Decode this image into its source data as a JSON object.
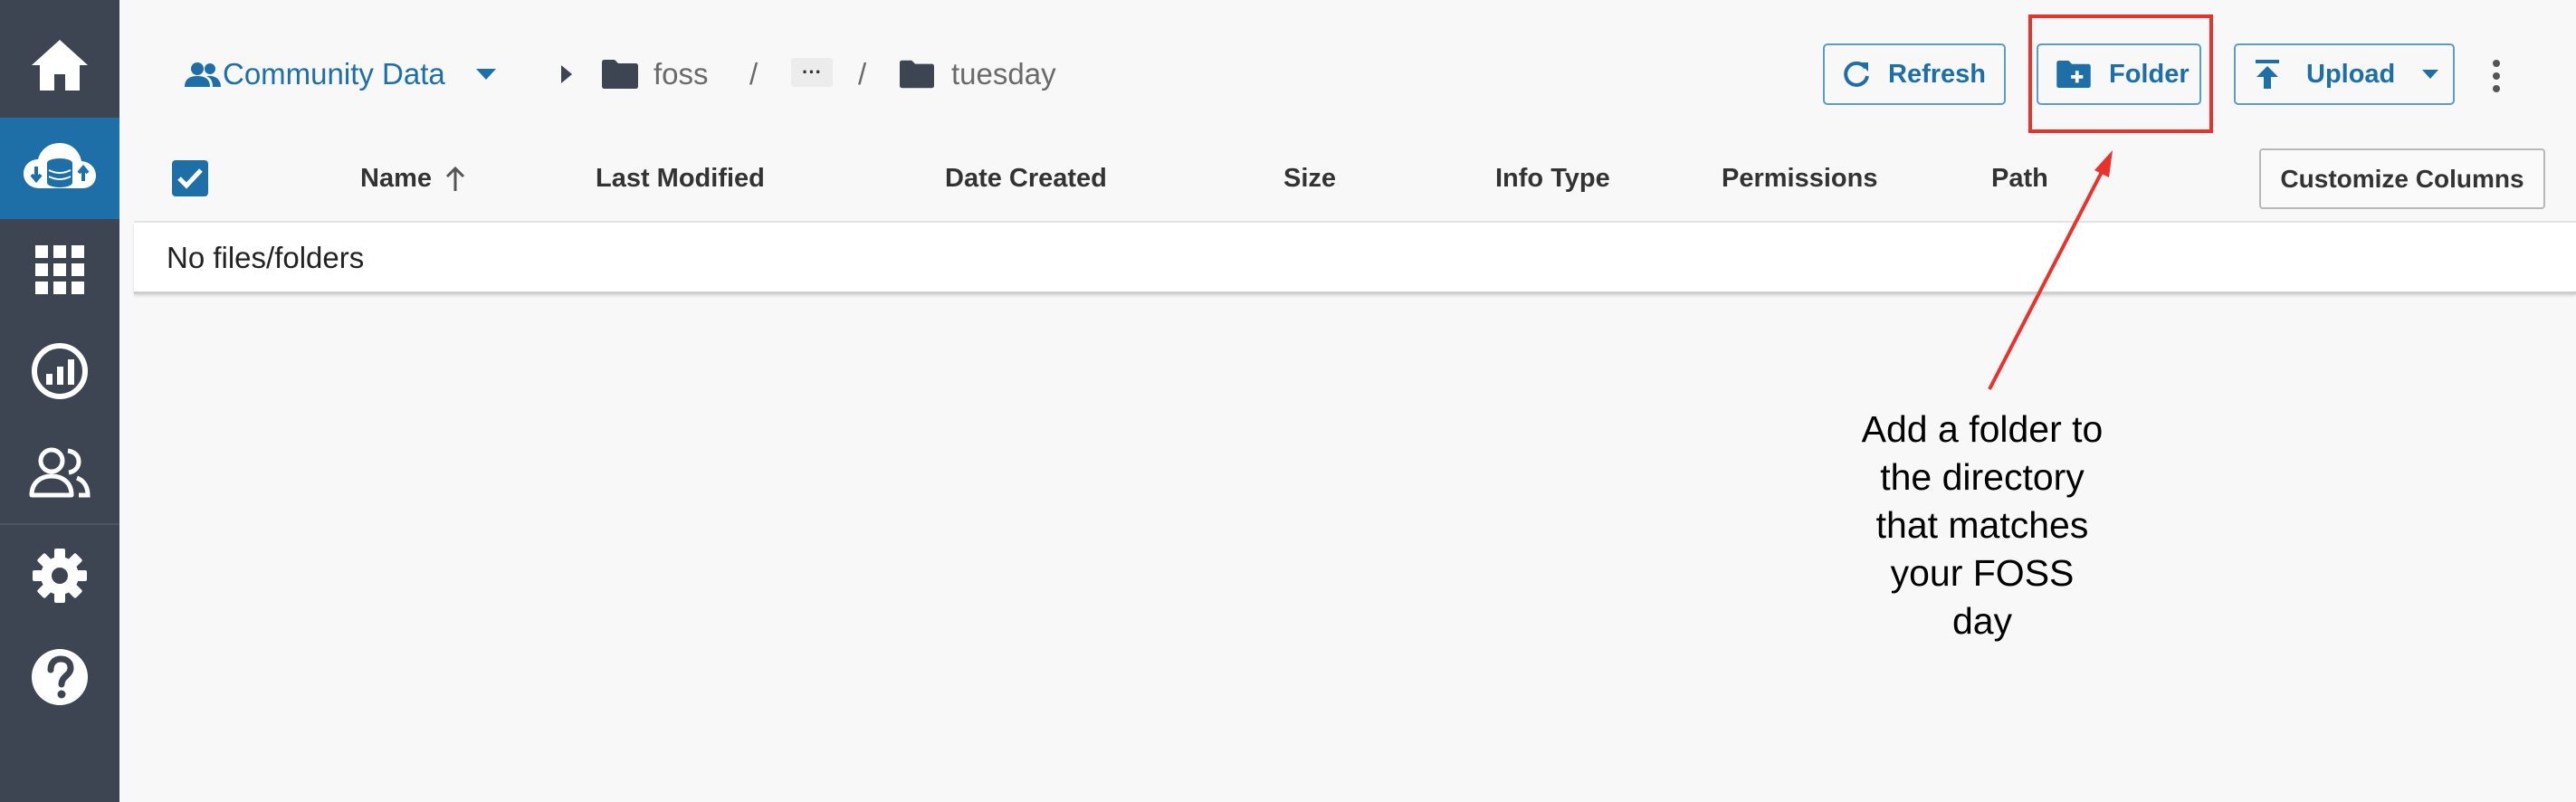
{
  "sidebar": {
    "items": [
      {
        "icon": "home-icon",
        "label": "Home"
      },
      {
        "icon": "cloud-data-icon",
        "label": "Data",
        "active": true
      },
      {
        "icon": "apps-grid-icon",
        "label": "Apps"
      },
      {
        "icon": "analyses-icon",
        "label": "Analyses"
      },
      {
        "icon": "teams-icon",
        "label": "Teams"
      },
      {
        "icon": "settings-icon",
        "label": "Settings"
      },
      {
        "icon": "help-icon",
        "label": "Help"
      }
    ]
  },
  "header": {
    "data_source": "Community Data",
    "breadcrumb": {
      "folder1": "foss",
      "separator": "/",
      "ellipsis": "···",
      "folder2": "tuesday"
    },
    "buttons": {
      "refresh": "Refresh",
      "folder": "Folder",
      "upload": "Upload"
    }
  },
  "table": {
    "columns": [
      "Name",
      "Last Modified",
      "Date Created",
      "Size",
      "Info Type",
      "Permissions",
      "Path"
    ],
    "customize_label": "Customize Columns",
    "empty_message": "No files/folders"
  },
  "annotation": {
    "lines": [
      "Add a folder to",
      "the directory",
      "that matches",
      "your FOSS",
      "day"
    ]
  },
  "colors": {
    "sidebar_bg": "#3e4552",
    "active_bg": "#1e6fa8",
    "accent": "#1e6fa8",
    "annotation": "#e8322b"
  }
}
